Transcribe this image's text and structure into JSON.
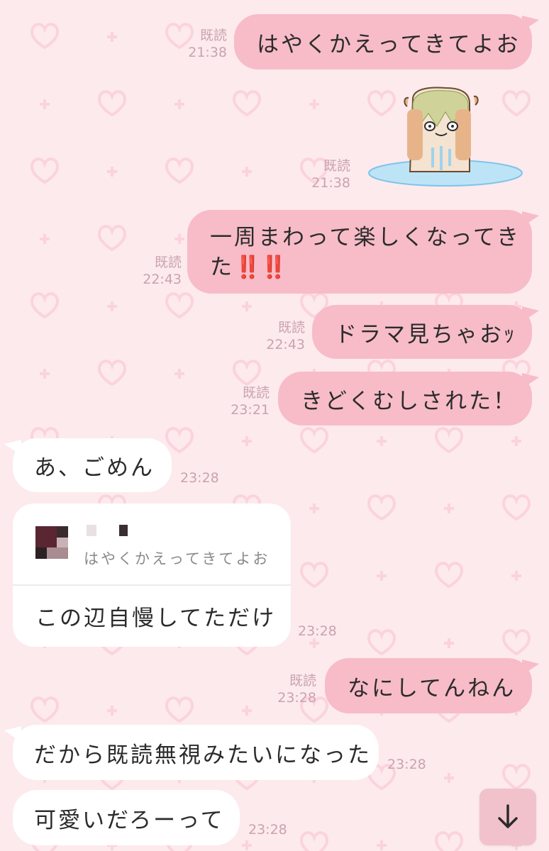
{
  "colors": {
    "background": "#fdeaed",
    "outgoing_bubble": "#f7bcc8",
    "incoming_bubble": "#ffffff",
    "meta_text": "#c9a3ae",
    "accent_exclamation": "#e2141c"
  },
  "messages": [
    {
      "dir": "out",
      "read": "既読",
      "time": "21:38",
      "text": "はやくかえってきてよお"
    },
    {
      "dir": "out",
      "type": "sticker",
      "sticker": "hamster-melting-sticker",
      "read": "既読",
      "time": "21:38"
    },
    {
      "dir": "out",
      "read": "既読",
      "time": "22:43",
      "line1": "一周まわって楽しくなってき",
      "line2": "た",
      "emphasis": "‼️‼️"
    },
    {
      "dir": "out",
      "read": "既読",
      "time": "22:43",
      "text": "ドラマ見ちゃおｯ"
    },
    {
      "dir": "out",
      "read": "既読",
      "time": "23:21",
      "text": "きどくむしされた！"
    },
    {
      "dir": "in",
      "time": "23:28",
      "text": "あ、ごめん"
    },
    {
      "dir": "in",
      "time": "23:28",
      "type": "reply",
      "quoted_text": "はやくかえってきてよお",
      "text": "この辺自慢してただけ"
    },
    {
      "dir": "out",
      "read": "既読",
      "time": "23:28",
      "text": "なにしてんねん"
    },
    {
      "dir": "in",
      "time": "23:28",
      "text": "だから既読無視みたいになった"
    },
    {
      "dir": "in",
      "time": "23:28",
      "text": "可愛いだろーって"
    }
  ],
  "scroll_button": {
    "icon": "arrow-down-icon"
  }
}
